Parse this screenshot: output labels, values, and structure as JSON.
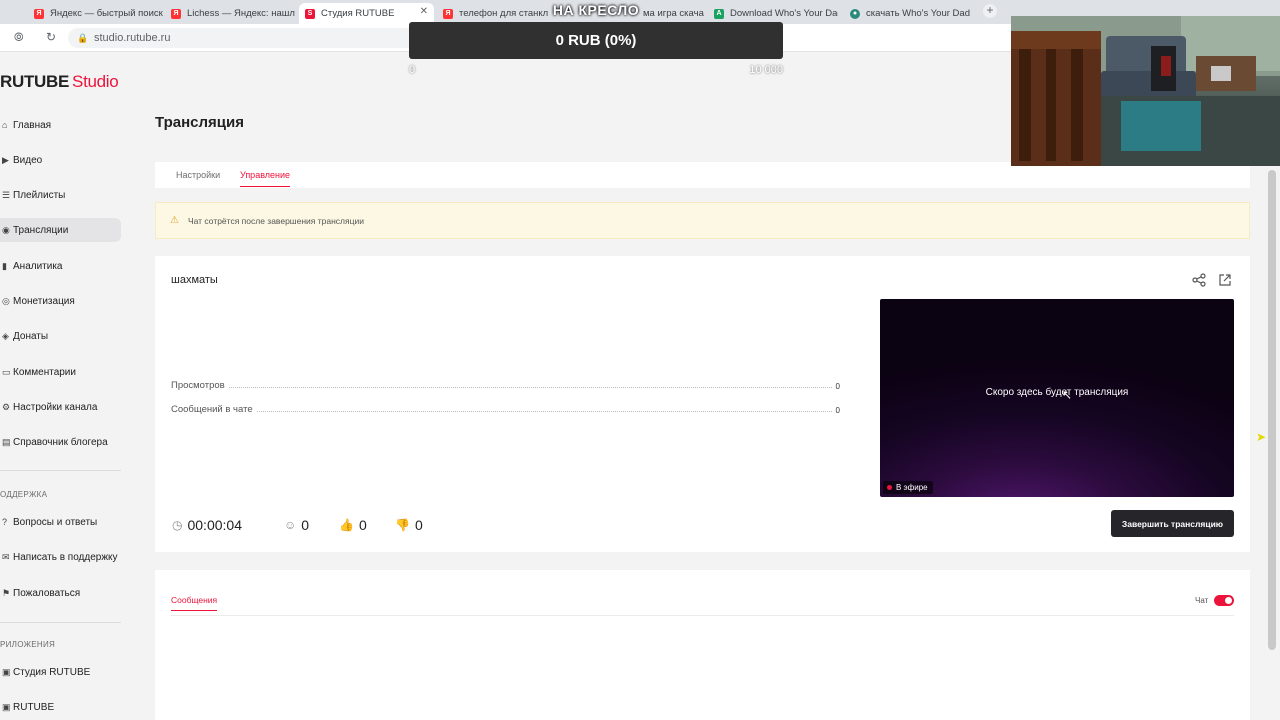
{
  "browser": {
    "tabs": [
      {
        "title": "Яндекс — быстрый поиск",
        "active": false
      },
      {
        "title": "Lichess — Яндекс: нашлось",
        "active": false
      },
      {
        "title": "Студия RUTUBE",
        "active": true
      },
      {
        "title": "телефон для станкл",
        "active": false
      },
      {
        "title": "ма игра скача",
        "active": false
      },
      {
        "title": "Download Who's Your Dad",
        "active": false
      },
      {
        "title": "скачать Who's Your Dad",
        "active": false
      }
    ],
    "url": "studio.rutube.ru"
  },
  "app": {
    "logo_main": "RUTUBE",
    "logo_studio": "Studio",
    "nav": [
      {
        "label": "Главная",
        "icon": "home-icon"
      },
      {
        "label": "Видео",
        "icon": "play-icon"
      },
      {
        "label": "Плейлисты",
        "icon": "playlist-icon"
      },
      {
        "label": "Трансляции",
        "icon": "broadcast-icon",
        "active": true
      },
      {
        "label": "Аналитика",
        "icon": "chart-icon"
      },
      {
        "label": "Монетизация",
        "icon": "coin-icon"
      },
      {
        "label": "Донаты",
        "icon": "donate-icon"
      },
      {
        "label": "Комментарии",
        "icon": "comment-icon"
      },
      {
        "label": "Настройки канала",
        "icon": "settings-icon"
      },
      {
        "label": "Справочник блогера",
        "icon": "book-icon"
      }
    ],
    "support_section": "ОДДЕРЖКА",
    "support_nav": [
      {
        "label": "Вопросы и ответы",
        "icon": "help-icon"
      },
      {
        "label": "Написать в поддержку",
        "icon": "mail-icon"
      },
      {
        "label": "Пожаловаться",
        "icon": "flag-icon"
      }
    ],
    "apps_section": "РИЛОЖЕНИЯ",
    "apps_nav": [
      {
        "label": "Студия RUTUBE",
        "icon": "studio-icon"
      },
      {
        "label": "RUTUBE",
        "icon": "rutube-icon"
      }
    ]
  },
  "page": {
    "title": "Трансляция",
    "tabs": [
      "Настройки",
      "Управление"
    ],
    "active_tab": "Управление",
    "warning": "Чат сотрётся после завершения трансляции",
    "stream": {
      "name": "шахматы",
      "stats": [
        {
          "label": "Просмотров",
          "value": "0"
        },
        {
          "label": "Сообщений в чате",
          "value": "0"
        }
      ],
      "player_message": "Скоро здесь будет трансляция",
      "live_label": "В эфире",
      "duration": "00:00:04",
      "viewers": "0",
      "likes": "0",
      "dislikes": "0",
      "end_button": "Завершить трансляцию"
    },
    "messages": {
      "tab": "Сообщения",
      "chat_label": "Чат",
      "chat_enabled": true
    }
  },
  "overlay": {
    "donation_title": "НА КРЕСЛО",
    "donation_amount": "0 RUB (0%)",
    "donation_min": "0",
    "donation_max": "10 000"
  },
  "colors": {
    "accent": "#ed143b",
    "dark_button": "#26262a",
    "warning_bg": "#fdf8e4"
  }
}
